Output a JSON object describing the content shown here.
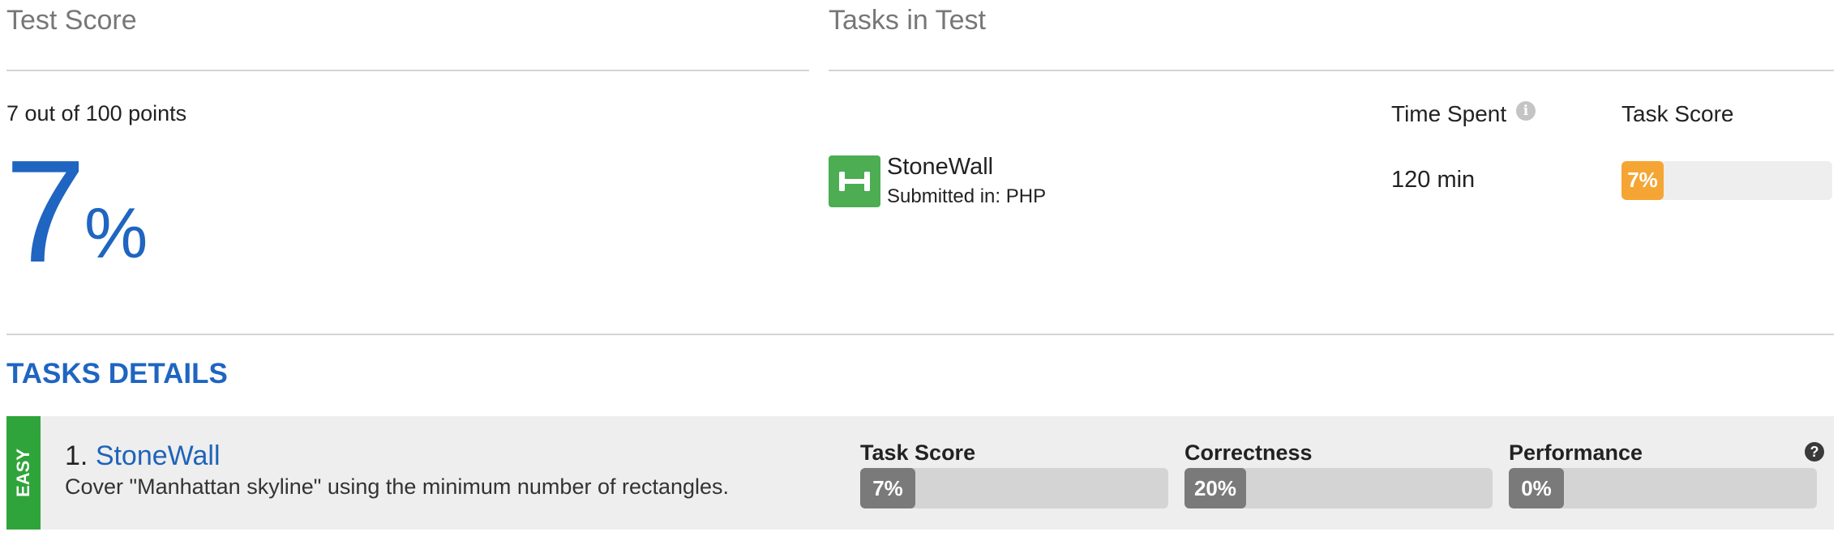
{
  "test_score": {
    "heading": "Test Score",
    "points_text": "7 out of 100 points",
    "percent_number": "7",
    "percent_sign": "%"
  },
  "tasks_in_test": {
    "heading": "Tasks in Test",
    "col_time": "Time Spent",
    "col_score": "Task Score",
    "info_icon": "i",
    "task": {
      "name": "StoneWall",
      "submitted": "Submitted in: PHP",
      "icon": "dumbbell-icon",
      "time": "120 min",
      "score_label": "7%",
      "score_fraction": 0.07
    }
  },
  "tasks_details": {
    "heading": "TASKS DETAILS",
    "difficulty": "EASY",
    "number": "1.",
    "name": "StoneWall",
    "description": "Cover \"Manhattan skyline\" using the minimum number of rectangles.",
    "help_icon": "?",
    "metrics": [
      {
        "label": "Task Score",
        "value": "7%",
        "fraction": 0.07
      },
      {
        "label": "Correctness",
        "value": "20%",
        "fraction": 0.2
      },
      {
        "label": "Performance",
        "value": "0%",
        "fraction": 0.0
      }
    ]
  },
  "colors": {
    "accent_blue": "#1f65c1",
    "easy_green": "#2fa43a",
    "task_icon_green": "#4cad53",
    "score_orange": "#f5a533"
  }
}
